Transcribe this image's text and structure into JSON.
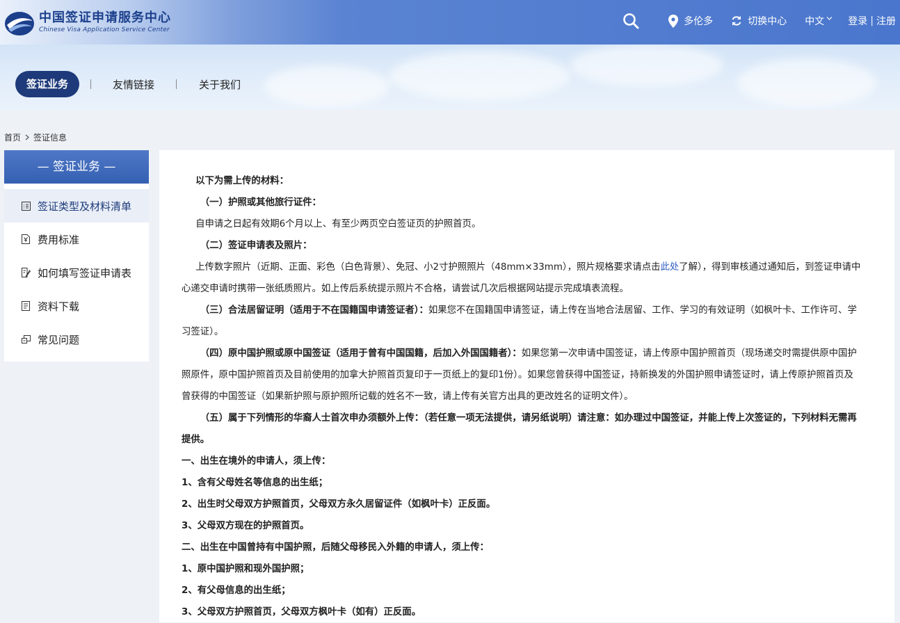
{
  "header": {
    "logo_cn": "中国签证申请服务中心",
    "logo_en": "Chinese Visa Application Service Center",
    "city": "多伦多",
    "switch_center": "切换中心",
    "language": "中文",
    "login": "登录",
    "divider": "|",
    "register": "注册"
  },
  "nav": {
    "active": "签证业务",
    "links": [
      "友情链接",
      "关于我们"
    ]
  },
  "breadcrumb": {
    "home": "首页",
    "current": "签证信息"
  },
  "sidebar": {
    "title": "— 签证业务 —",
    "items": [
      {
        "label": "签证类型及材料清单",
        "icon": "list-icon",
        "active": true
      },
      {
        "label": "费用标准",
        "icon": "yen-doc-icon",
        "active": false
      },
      {
        "label": "如何填写签证申请表",
        "icon": "pencil-doc-icon",
        "active": false
      },
      {
        "label": "资料下载",
        "icon": "document-icon",
        "active": false
      },
      {
        "label": "常见问题",
        "icon": "question-icon",
        "active": false
      }
    ]
  },
  "content": {
    "intro": "以下为需上传的材料：",
    "s1_title": "（一）护照或其他旅行证件：",
    "s1_text": "自申请之日起有效期6个月以上、有至少两页空白签证页的护照首页。",
    "s2_title": "（二）签证申请表及照片：",
    "s2_text_a": "上传数字照片（近期、正面、彩色（白色背景）、免冠、小2寸护照照片（48mm×33mm），照片规格要求请点击",
    "s2_link": "此处",
    "s2_text_b": "了解），得到审核通过通知后，到签证申请中心递交申请时携带一张纸质照片。如上传后系统提示照片不合格，请尝试几次后根据网站提示完成填表流程。",
    "s3_title": "（三）合法居留证明（适用于不在国籍国申请签证者）：",
    "s3_text": "如果您不在国籍国申请签证，请上传在当地合法居留、工作、学习的有效证明（如枫叶卡、工作许可、学习签证）。",
    "s4_title": "（四）原中国护照或原中国签证（适用于曾有中国国籍，后加入外国国籍者）：",
    "s4_text": "如果您第一次申请中国签证，请上传原中国护照首页（现场递交时需提供原中国护照原件，原中国护照首页及目前使用的加拿大护照首页复印于一页纸上的复印1份）。如果您曾获得中国签证，持新换发的外国护照申请签证时，请上传原护照首页及曾获得的中国签证（如果新护照与原护照所记载的姓名不一致，请上传有关官方出具的更改姓名的证明文件）。",
    "s5_title": "（五）属于下列情形的华裔人士首次申办须额外上传：（若任意一项无法提供，请另纸说明）请注意：如办理过中国签证，并能上传上次签证的，下列材料无需再提供。",
    "g1_title": "一、出生在境外的申请人，须上传：",
    "g1_items": [
      "1、含有父母姓名等信息的出生纸；",
      "2、出生时父母双方护照首页，父母双方永久居留证件（如枫叶卡）正反面。",
      "3、父母双方现在的护照首页。"
    ],
    "g2_title": "二、出生在中国曾持有中国护照，后随父母移民入外籍的申请人，须上传：",
    "g2_items": [
      "1、原中国护照和现外国护照；",
      "2、有父母信息的出生纸；",
      "3、父母双方护照首页，父母双方枫叶卡（如有）正反面。"
    ]
  }
}
